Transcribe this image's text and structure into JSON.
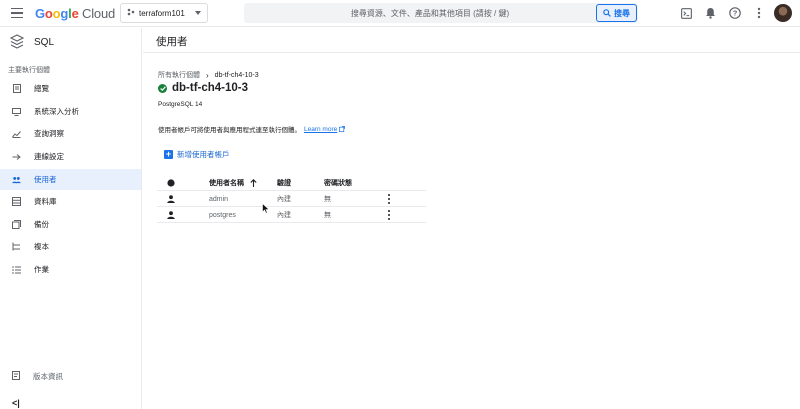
{
  "header": {
    "logo": {
      "g": "G",
      "o1": "o",
      "o2": "o",
      "g2": "g",
      "l": "l",
      "e": "e",
      "cloud": "Cloud"
    },
    "project": "terraform101",
    "search_placeholder": "搜尋資源、文件、產品和其他項目 (請按 / 鍵)",
    "search_button": "搜尋",
    "icons": [
      "menu-icon",
      "terminal-icon",
      "bell-icon",
      "help-icon",
      "more-vert-icon"
    ]
  },
  "sidebar": {
    "product": "SQL",
    "section": "主要執行個體",
    "items": [
      {
        "label": "總覽",
        "icon": "dashboard-icon",
        "active": false
      },
      {
        "label": "系統深入分析",
        "icon": "monitor-icon",
        "active": false
      },
      {
        "label": "查詢洞察",
        "icon": "chart-icon",
        "active": false
      },
      {
        "label": "連線設定",
        "icon": "connection-icon",
        "active": false
      },
      {
        "label": "使用者",
        "icon": "users-icon",
        "active": true
      },
      {
        "label": "資料庫",
        "icon": "database-icon",
        "active": false
      },
      {
        "label": "備份",
        "icon": "backup-icon",
        "active": false
      },
      {
        "label": "複本",
        "icon": "replica-icon",
        "active": false
      },
      {
        "label": "作業",
        "icon": "list-icon",
        "active": false
      }
    ],
    "release_notes": "版本資訊",
    "collapse": "<|"
  },
  "main": {
    "page_title": "使用者",
    "breadcrumb": {
      "parent": "所有執行個體",
      "current": "db-tf-ch4-10-3"
    },
    "instance_name": "db-tf-ch4-10-3",
    "instance_version": "PostgreSQL 14",
    "description": "使用者帳戶可將使用者與應用程式連至執行個體。",
    "learn_more": "Learn more",
    "add_user": "新增使用者帳戶",
    "table": {
      "headers": {
        "name": "使用者名稱",
        "auth": "驗證",
        "password": "密碼狀態"
      },
      "rows": [
        {
          "name": "admin",
          "auth": "內建",
          "password": "無"
        },
        {
          "name": "postgres",
          "auth": "內建",
          "password": "無"
        }
      ]
    }
  },
  "colors": {
    "accent": "#1a73e8",
    "active_bg": "#e8f0fe",
    "ok": "#188038"
  }
}
